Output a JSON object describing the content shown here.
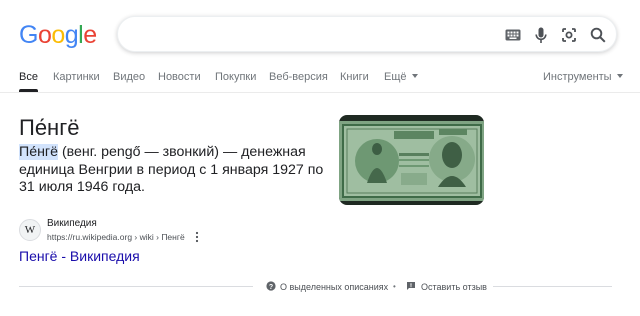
{
  "logo": {
    "letters": [
      "G",
      "o",
      "o",
      "g",
      "l",
      "e"
    ]
  },
  "colors": {
    "blue": "#4285f4",
    "red": "#ea4335",
    "yellow": "#fbbc05",
    "green": "#34a853",
    "link": "#1a0dab"
  },
  "search": {
    "value": "",
    "placeholder": ""
  },
  "icons": [
    "keyboard-icon",
    "mic-icon",
    "lens-icon",
    "search-icon",
    "help-icon",
    "feedback-icon"
  ],
  "tabs": [
    {
      "label": "Все",
      "active": true
    },
    {
      "label": "Картинки"
    },
    {
      "label": "Видео"
    },
    {
      "label": "Новости"
    },
    {
      "label": "Покупки"
    },
    {
      "label": "Веб-версия"
    },
    {
      "label": "Книги"
    },
    {
      "label": "Ещё"
    }
  ],
  "tools_label": "Инструменты",
  "result": {
    "title": "Пе́нгё",
    "term": "Пе́нгё",
    "description": " (венг. pengő — звонкий) — денежная единица Венгрии в период с 1 января 1927 по 31 июля 1946 года."
  },
  "source": {
    "favicon_letter": "W",
    "name": "Википедия",
    "url": "https://ru.wikipedia.org › wiki › Пенгё",
    "link_text": "Пенгё - Википедия"
  },
  "feedback": {
    "about": "О выделенных описаниях",
    "report": "Оставить отзыв"
  }
}
